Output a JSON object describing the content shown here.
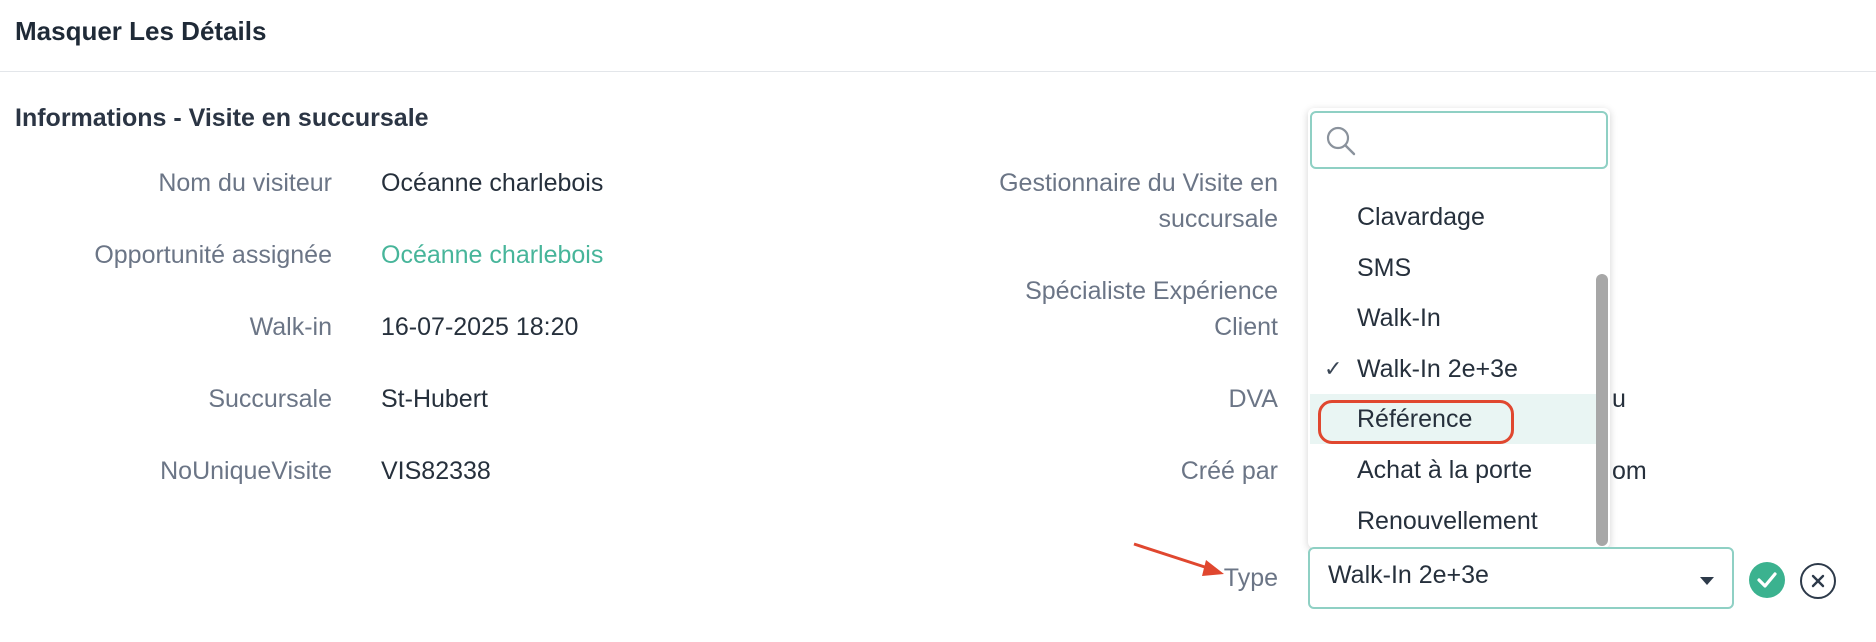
{
  "header": {
    "title": "Masquer Les Détails"
  },
  "section": {
    "title": "Informations - Visite en succursale"
  },
  "left_fields": [
    {
      "label": "Nom du visiteur",
      "value": "Océanne charlebois"
    },
    {
      "label": "Opportunité assignée",
      "value": "Océanne charlebois"
    },
    {
      "label": "Walk-in",
      "value": "16-07-2025 18:20"
    },
    {
      "label": "Succursale",
      "value": "St-Hubert"
    },
    {
      "label": "NoUniqueVisite",
      "value": "VIS82338"
    }
  ],
  "right_fields": {
    "manager_label_line1": "Gestionnaire du Visite en",
    "manager_label_line2": "succursale",
    "specialist_label_line1": "Spécialiste Expérience",
    "specialist_label_line2": "Client",
    "dva_label": "DVA",
    "dva_value_peek": "u",
    "created_by_label": "Créé par",
    "created_by_value_peek": "om",
    "type_label": "Type"
  },
  "dropdown": {
    "search_placeholder": "",
    "options": [
      {
        "label": "Clavardage",
        "checked": false
      },
      {
        "label": "SMS",
        "checked": false
      },
      {
        "label": "Walk-In",
        "checked": false
      },
      {
        "label": "Walk-In 2e+3e",
        "checked": true
      },
      {
        "label": "Référence",
        "checked": false,
        "hovered": true
      },
      {
        "label": "Achat à la porte",
        "checked": false
      },
      {
        "label": "Renouvellement",
        "checked": false
      }
    ],
    "check_glyph": "✓"
  },
  "type_select": {
    "value": "Walk-In 2e+3e"
  },
  "icons": {
    "search": "search-icon",
    "check": "check-icon",
    "confirm": "confirm-check-icon",
    "cancel": "cancel-x-icon",
    "caret": "caret-down-icon"
  },
  "colors": {
    "link": "#47b59a",
    "focus_border": "#8fd0c4",
    "confirm": "#3bb28f",
    "annotation": "#e0472f",
    "hover_bg": "#e9f5f3"
  }
}
